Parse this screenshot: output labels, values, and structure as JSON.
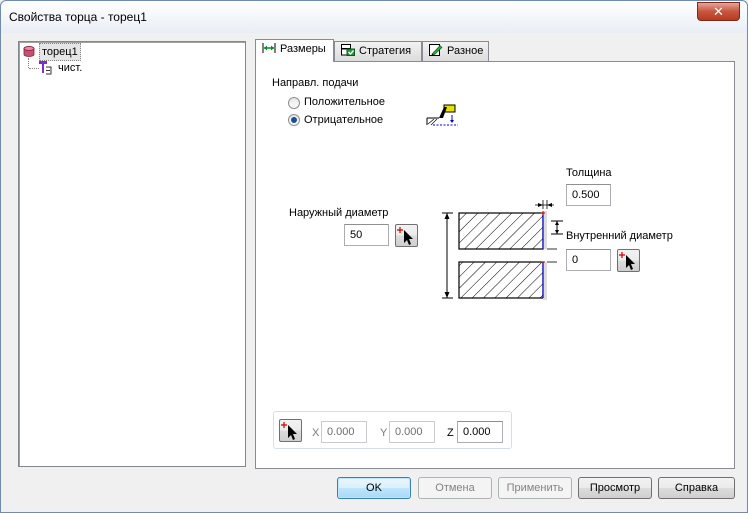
{
  "window": {
    "title": "Свойства торца - торец1",
    "close_glyph": "✕"
  },
  "tree": {
    "root_label": "торец1",
    "root_icon": "database-icon",
    "child_label": "чист.",
    "child_icon": "tool-icon"
  },
  "tabs": [
    {
      "label": "Размеры",
      "icon": "dimensions-icon"
    },
    {
      "label": "Стратегия",
      "icon": "strategy-icon"
    },
    {
      "label": "Разное",
      "icon": "misc-icon"
    }
  ],
  "feed": {
    "label": "Направл. подачи",
    "positive": "Положительное",
    "negative": "Отрицательное",
    "selected": "negative"
  },
  "thickness": {
    "label": "Толщина",
    "value": "0.500"
  },
  "outer_diameter": {
    "label": "Наружный диаметр",
    "value": "50"
  },
  "inner_diameter": {
    "label": "Внутренний диаметр",
    "value": "0"
  },
  "coords": {
    "x_label": "X",
    "x_value": "0.000",
    "y_label": "Y",
    "y_value": "0.000",
    "z_label": "Z",
    "z_value": "0.000"
  },
  "buttons": {
    "ok": "OK",
    "cancel": "Отмена",
    "apply": "Применить",
    "preview": "Просмотр",
    "help": "Справка"
  },
  "colors": {
    "accent_red": "#cc0000",
    "edge_blue": "#0000cc",
    "default_button_border": "#3c7fb1"
  }
}
